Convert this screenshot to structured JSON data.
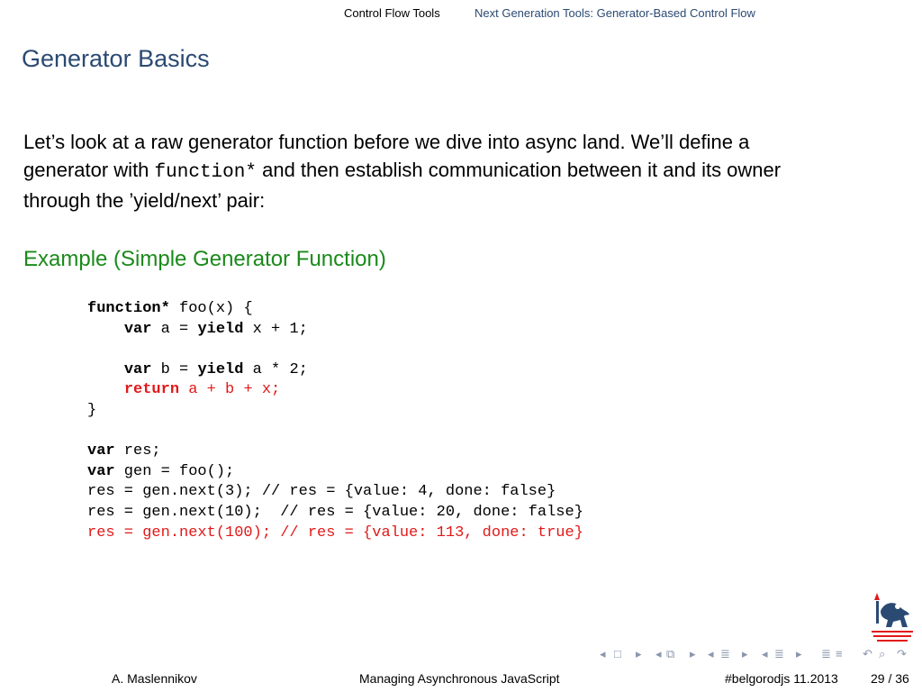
{
  "nav": {
    "section": "Control Flow Tools",
    "subsection": "Next Generation Tools: Generator-Based Control Flow"
  },
  "frame": {
    "title": "Generator Basics"
  },
  "body": {
    "line1": "Let’s look at a raw generator function before we dive into async land. We’ll define a",
    "line2_before": "generator with",
    "line2_code": "function*",
    "line2_after": "and then establish communication between it and its owner",
    "line3": "through the ’yield/next’ pair:"
  },
  "example": {
    "title": "Example (Simple Generator Function)"
  },
  "code": {
    "l1_kw": "function*",
    "l1_rest": " foo(x) {",
    "l2_indent": "    ",
    "l2_kw1": "var",
    "l2_mid": " a = ",
    "l2_kw2": "yield",
    "l2_rest": " x + 1;",
    "l4_indent": "    ",
    "l4_kw1": "var",
    "l4_mid": " b = ",
    "l4_kw2": "yield",
    "l4_rest": " a * 2;",
    "l5_indent": "    ",
    "l5_kw": "return",
    "l5_rest": " a + b + x;",
    "l6": "}",
    "l8_kw": "var",
    "l8_rest": " res;",
    "l9_kw": "var",
    "l9_rest": " gen = foo();",
    "l10": "res = gen.next(3); // res = {value: 4, done: false}",
    "l11": "res = gen.next(10);  // res = {value: 20, done: false}",
    "l12": "res = gen.next(100); // res = {value: 113, done: true}"
  },
  "navigation_symbols": {
    "icons": [
      "triangle-left",
      "frame-box",
      "triangle-right",
      "triangle-left",
      "subsection-box",
      "triangle-right",
      "triangle-left",
      "section-list",
      "triangle-right",
      "triangle-left",
      "subsection-list",
      "triangle-right",
      "section-list",
      "section-list-dense",
      "back-arrow",
      "search",
      "forward-arrow"
    ]
  },
  "footer": {
    "author": "A. Maslennikov",
    "talk_title": "Managing Asynchronous JavaScript",
    "event": "#belgorodjs 11.2013",
    "page": "29 / 36"
  },
  "colors": {
    "structure": "#2b4a73",
    "example_title": "#1a8a1a",
    "alert": "#e11919",
    "nav_symbols": "#8a97ad"
  }
}
